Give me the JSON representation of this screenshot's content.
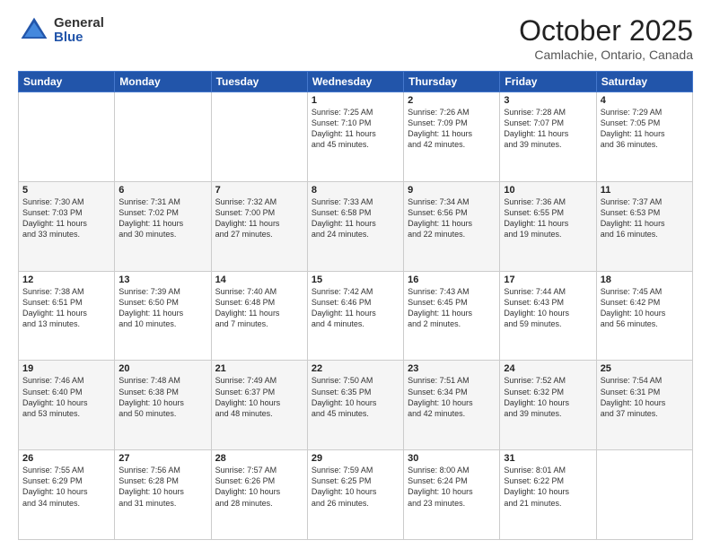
{
  "header": {
    "logo_general": "General",
    "logo_blue": "Blue",
    "month": "October 2025",
    "location": "Camlachie, Ontario, Canada"
  },
  "days_of_week": [
    "Sunday",
    "Monday",
    "Tuesday",
    "Wednesday",
    "Thursday",
    "Friday",
    "Saturday"
  ],
  "weeks": [
    [
      {
        "day": "",
        "info": ""
      },
      {
        "day": "",
        "info": ""
      },
      {
        "day": "",
        "info": ""
      },
      {
        "day": "1",
        "info": "Sunrise: 7:25 AM\nSunset: 7:10 PM\nDaylight: 11 hours\nand 45 minutes."
      },
      {
        "day": "2",
        "info": "Sunrise: 7:26 AM\nSunset: 7:09 PM\nDaylight: 11 hours\nand 42 minutes."
      },
      {
        "day": "3",
        "info": "Sunrise: 7:28 AM\nSunset: 7:07 PM\nDaylight: 11 hours\nand 39 minutes."
      },
      {
        "day": "4",
        "info": "Sunrise: 7:29 AM\nSunset: 7:05 PM\nDaylight: 11 hours\nand 36 minutes."
      }
    ],
    [
      {
        "day": "5",
        "info": "Sunrise: 7:30 AM\nSunset: 7:03 PM\nDaylight: 11 hours\nand 33 minutes."
      },
      {
        "day": "6",
        "info": "Sunrise: 7:31 AM\nSunset: 7:02 PM\nDaylight: 11 hours\nand 30 minutes."
      },
      {
        "day": "7",
        "info": "Sunrise: 7:32 AM\nSunset: 7:00 PM\nDaylight: 11 hours\nand 27 minutes."
      },
      {
        "day": "8",
        "info": "Sunrise: 7:33 AM\nSunset: 6:58 PM\nDaylight: 11 hours\nand 24 minutes."
      },
      {
        "day": "9",
        "info": "Sunrise: 7:34 AM\nSunset: 6:56 PM\nDaylight: 11 hours\nand 22 minutes."
      },
      {
        "day": "10",
        "info": "Sunrise: 7:36 AM\nSunset: 6:55 PM\nDaylight: 11 hours\nand 19 minutes."
      },
      {
        "day": "11",
        "info": "Sunrise: 7:37 AM\nSunset: 6:53 PM\nDaylight: 11 hours\nand 16 minutes."
      }
    ],
    [
      {
        "day": "12",
        "info": "Sunrise: 7:38 AM\nSunset: 6:51 PM\nDaylight: 11 hours\nand 13 minutes."
      },
      {
        "day": "13",
        "info": "Sunrise: 7:39 AM\nSunset: 6:50 PM\nDaylight: 11 hours\nand 10 minutes."
      },
      {
        "day": "14",
        "info": "Sunrise: 7:40 AM\nSunset: 6:48 PM\nDaylight: 11 hours\nand 7 minutes."
      },
      {
        "day": "15",
        "info": "Sunrise: 7:42 AM\nSunset: 6:46 PM\nDaylight: 11 hours\nand 4 minutes."
      },
      {
        "day": "16",
        "info": "Sunrise: 7:43 AM\nSunset: 6:45 PM\nDaylight: 11 hours\nand 2 minutes."
      },
      {
        "day": "17",
        "info": "Sunrise: 7:44 AM\nSunset: 6:43 PM\nDaylight: 10 hours\nand 59 minutes."
      },
      {
        "day": "18",
        "info": "Sunrise: 7:45 AM\nSunset: 6:42 PM\nDaylight: 10 hours\nand 56 minutes."
      }
    ],
    [
      {
        "day": "19",
        "info": "Sunrise: 7:46 AM\nSunset: 6:40 PM\nDaylight: 10 hours\nand 53 minutes."
      },
      {
        "day": "20",
        "info": "Sunrise: 7:48 AM\nSunset: 6:38 PM\nDaylight: 10 hours\nand 50 minutes."
      },
      {
        "day": "21",
        "info": "Sunrise: 7:49 AM\nSunset: 6:37 PM\nDaylight: 10 hours\nand 48 minutes."
      },
      {
        "day": "22",
        "info": "Sunrise: 7:50 AM\nSunset: 6:35 PM\nDaylight: 10 hours\nand 45 minutes."
      },
      {
        "day": "23",
        "info": "Sunrise: 7:51 AM\nSunset: 6:34 PM\nDaylight: 10 hours\nand 42 minutes."
      },
      {
        "day": "24",
        "info": "Sunrise: 7:52 AM\nSunset: 6:32 PM\nDaylight: 10 hours\nand 39 minutes."
      },
      {
        "day": "25",
        "info": "Sunrise: 7:54 AM\nSunset: 6:31 PM\nDaylight: 10 hours\nand 37 minutes."
      }
    ],
    [
      {
        "day": "26",
        "info": "Sunrise: 7:55 AM\nSunset: 6:29 PM\nDaylight: 10 hours\nand 34 minutes."
      },
      {
        "day": "27",
        "info": "Sunrise: 7:56 AM\nSunset: 6:28 PM\nDaylight: 10 hours\nand 31 minutes."
      },
      {
        "day": "28",
        "info": "Sunrise: 7:57 AM\nSunset: 6:26 PM\nDaylight: 10 hours\nand 28 minutes."
      },
      {
        "day": "29",
        "info": "Sunrise: 7:59 AM\nSunset: 6:25 PM\nDaylight: 10 hours\nand 26 minutes."
      },
      {
        "day": "30",
        "info": "Sunrise: 8:00 AM\nSunset: 6:24 PM\nDaylight: 10 hours\nand 23 minutes."
      },
      {
        "day": "31",
        "info": "Sunrise: 8:01 AM\nSunset: 6:22 PM\nDaylight: 10 hours\nand 21 minutes."
      },
      {
        "day": "",
        "info": ""
      }
    ]
  ]
}
